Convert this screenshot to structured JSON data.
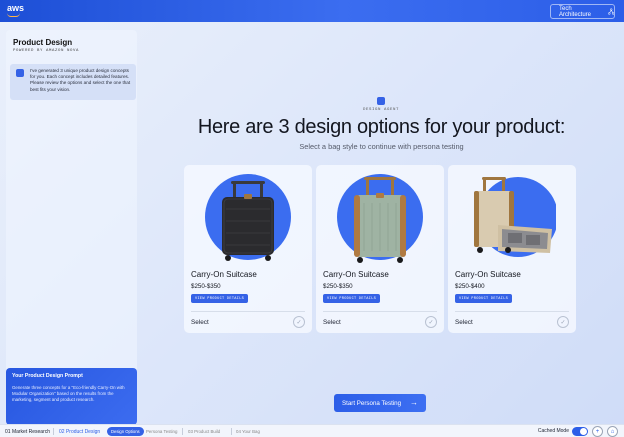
{
  "header": {
    "logo_text": "aws",
    "tech_button_label": "Tech Architecture"
  },
  "sidebar": {
    "title": "Product Design",
    "subtitle": "POWERED BY AMAZON NOVA",
    "message": "I've generated 3 unique product design concepts for you. Each concept includes detailed features. Please review the options and select the one that best fits your vision.",
    "prompt_title": "Your Product Design Prompt",
    "prompt_text": "Generate three concepts for a \"Eco-friendly Carry-On with Modular Organization\" based on the results from the marketing, segment and product research."
  },
  "main": {
    "agent_label": "DESIGN AGENT",
    "headline": "Here are 3 design options for your product:",
    "subline": "Select a bag style to continue with persona testing",
    "cards": [
      {
        "title": "Carry-On Suitcase",
        "price": "$250-$350",
        "details_label": "VIEW PRODUCT DETAILS",
        "select_label": "Select",
        "color": "#2b2b2e"
      },
      {
        "title": "Carry-On Suitcase",
        "price": "$250-$350",
        "details_label": "VIEW PRODUCT DETAILS",
        "select_label": "Select",
        "color": "#9fb3a3"
      },
      {
        "title": "Carry-On Suitcase",
        "price": "$250-$400",
        "details_label": "VIEW PRODUCT DETAILS",
        "select_label": "Select",
        "color": "#d9cbb0"
      }
    ],
    "start_button_label": "Start Persona Testing"
  },
  "bottom_nav": {
    "steps": [
      {
        "label": "01 Market Research"
      },
      {
        "label": "02 Product Design"
      },
      {
        "label": "Design Options"
      },
      {
        "label": "Persona Testing"
      },
      {
        "label": "03 Product Build"
      },
      {
        "label": "04 Your Bag"
      }
    ],
    "cached_mode_label": "Cached Mode",
    "cached_mode_on": true
  },
  "colors": {
    "accent": "#3562e6",
    "topbar": "#1d4fd6",
    "circle_bg": "#3b6df0"
  }
}
